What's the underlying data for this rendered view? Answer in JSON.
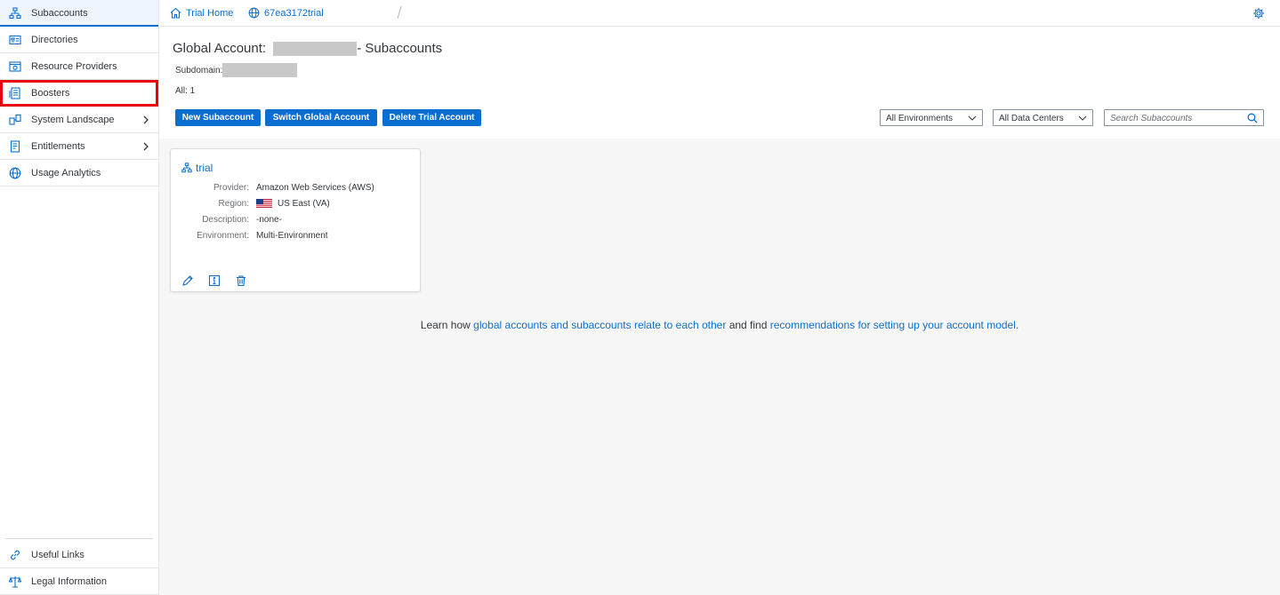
{
  "sidebar": {
    "items": [
      {
        "label": "Subaccounts",
        "icon": "subaccounts-icon",
        "selected": true
      },
      {
        "label": "Directories",
        "icon": "directories-icon"
      },
      {
        "label": "Resource Providers",
        "icon": "resource-providers-icon"
      },
      {
        "label": "Boosters",
        "icon": "boosters-icon",
        "highlighted": true
      },
      {
        "label": "System Landscape",
        "icon": "system-landscape-icon",
        "expandable": true
      },
      {
        "label": "Entitlements",
        "icon": "entitlements-icon",
        "expandable": true
      },
      {
        "label": "Usage Analytics",
        "icon": "globe-icon"
      }
    ],
    "footer": [
      {
        "label": "Useful Links",
        "icon": "link-icon"
      },
      {
        "label": "Legal Information",
        "icon": "scales-icon"
      }
    ]
  },
  "breadcrumb": {
    "home": "Trial Home",
    "current": "67ea3172trial"
  },
  "header": {
    "title_prefix": "Global Account:",
    "title_suffix": "- Subaccounts",
    "subdomain_label": "Subdomain:",
    "count": "All: 1"
  },
  "toolbar": {
    "new_subaccount": "New Subaccount",
    "switch_global_account": "Switch Global Account",
    "delete_trial_account": "Delete Trial Account",
    "environment_filter": "All Environments",
    "datacenter_filter": "All Data Centers",
    "search_placeholder": "Search Subaccounts"
  },
  "tile": {
    "name": "trial",
    "rows": [
      {
        "label": "Provider:",
        "value": "Amazon Web Services (AWS)"
      },
      {
        "label": "Region:",
        "value": "US East (VA)",
        "flag": "us-flag"
      },
      {
        "label": "Description:",
        "value": "-none-"
      },
      {
        "label": "Environment:",
        "value": "Multi-Environment"
      }
    ],
    "actions": [
      "edit-icon",
      "info-icon",
      "delete-icon"
    ]
  },
  "learn_more": {
    "prefix": "Learn how ",
    "link1": "global accounts and subaccounts relate to each other",
    "middle": " and find ",
    "link2": "recommendations for setting up your account model."
  },
  "colors": {
    "brand": "#0a6ed1",
    "highlight": "#e8000c",
    "text": "#32363a",
    "content_bg": "#f7f7f7"
  }
}
